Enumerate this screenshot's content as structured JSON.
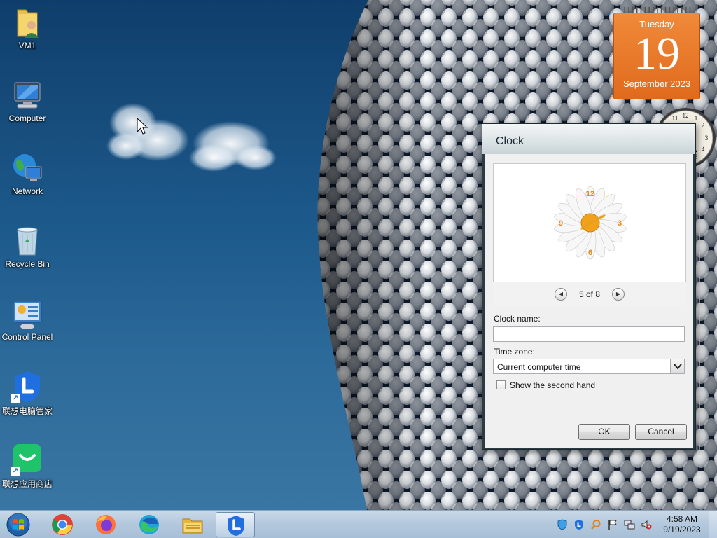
{
  "desktop": {
    "icons": [
      {
        "label": "VM1",
        "icon": "user-folder-icon"
      },
      {
        "label": "Computer",
        "icon": "computer-icon"
      },
      {
        "label": "Network",
        "icon": "network-icon"
      },
      {
        "label": "Recycle Bin",
        "icon": "recycle-bin-icon"
      },
      {
        "label": "Control Panel",
        "icon": "control-panel-icon"
      },
      {
        "label": "联想电脑管家",
        "icon": "lenovo-pc-manager-icon"
      },
      {
        "label": "联想应用商店",
        "icon": "lenovo-app-store-icon"
      }
    ]
  },
  "calendar_gadget": {
    "day_name": "Tuesday",
    "date": "19",
    "month_year": "September 2023",
    "accent": "#e8762a"
  },
  "clock_dialog": {
    "title": "Clock",
    "preview_counter": "5 of 8",
    "clock_name_label": "Clock name:",
    "clock_name_value": "",
    "time_zone_label": "Time zone:",
    "time_zone_value": "Current computer time",
    "second_hand_label": "Show the second hand",
    "second_hand_checked": false,
    "ok_label": "OK",
    "cancel_label": "Cancel"
  },
  "taskbar": {
    "pinned": [
      "start-orb-icon",
      "chrome-icon",
      "firefox-icon",
      "edge-icon",
      "file-explorer-icon",
      "lenovo-pc-manager-icon"
    ],
    "tray_icons": [
      "shield-icon",
      "lenovo-tray-icon",
      "search-magnifier-icon",
      "flag-icon",
      "network-tray-icon",
      "volume-muted-icon"
    ],
    "time": "4:58 AM",
    "date": "9/19/2023"
  }
}
